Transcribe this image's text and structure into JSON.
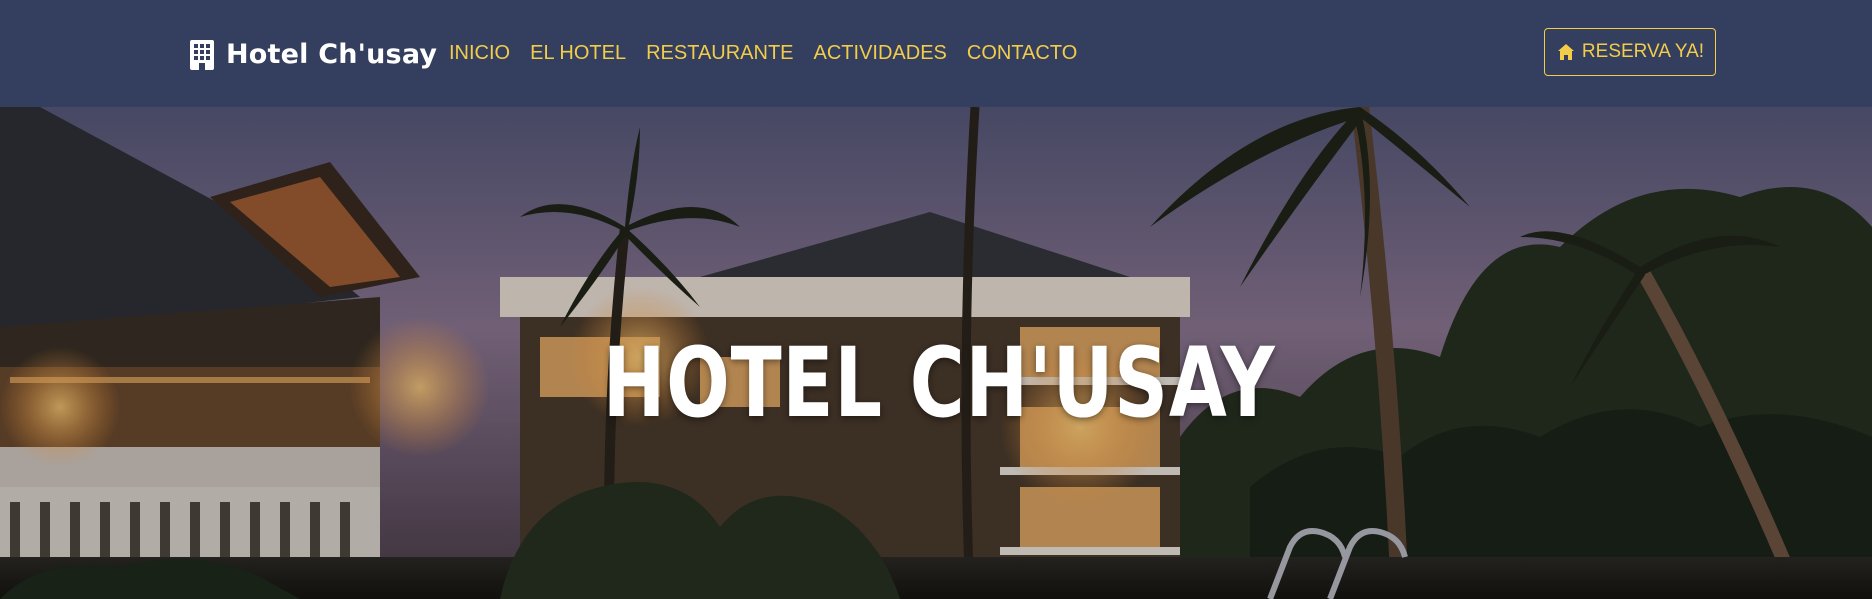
{
  "navbar": {
    "brand": {
      "name": "Hotel Ch'usay",
      "icon": "building-icon"
    },
    "links": [
      {
        "label": "INICIO"
      },
      {
        "label": "EL HOTEL"
      },
      {
        "label": "RESTAURANTE"
      },
      {
        "label": "ACTIVIDADES"
      },
      {
        "label": "CONTACTO"
      }
    ],
    "cta": {
      "label": "RESERVA YA!",
      "icon": "house-icon"
    }
  },
  "hero": {
    "title": "HOTEL CH'USAY",
    "image": "resort-hotel-at-dusk-with-palm-trees-and-pool"
  },
  "colors": {
    "navbar_bg": "#343e5e",
    "accent": "#f2cd4a",
    "text_light": "#ffffff"
  }
}
